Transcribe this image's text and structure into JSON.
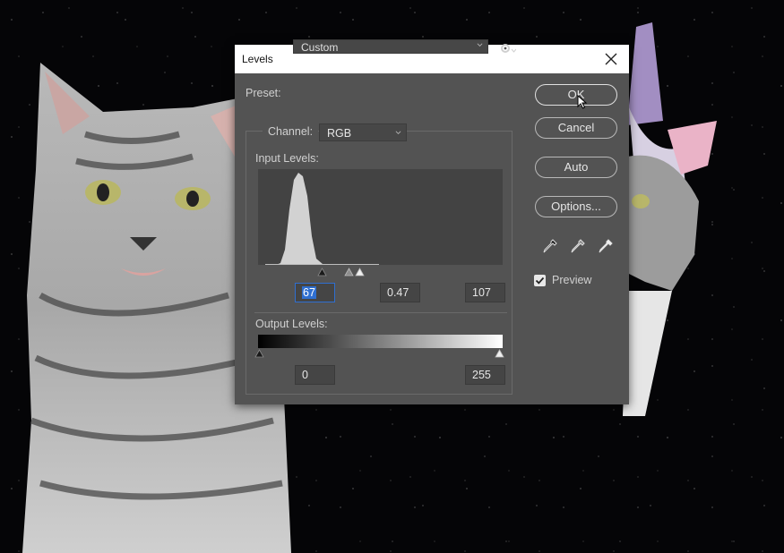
{
  "dialog": {
    "title": "Levels",
    "preset_label": "Preset:",
    "preset_value": "Custom",
    "channel_label": "Channel:",
    "channel_value": "RGB",
    "input_levels_label": "Input Levels:",
    "output_levels_label": "Output Levels:",
    "input_black": "67",
    "input_gamma": "0.47",
    "input_white": "107",
    "output_black": "0",
    "output_white": "255",
    "buttons": {
      "ok": "OK",
      "cancel": "Cancel",
      "auto": "Auto",
      "options": "Options..."
    },
    "preview_label": "Preview",
    "preview_checked": true
  },
  "icons": {
    "close": "close-icon",
    "gear": "gear-icon",
    "eyedropper_black": "eyedropper-black-icon",
    "eyedropper_gray": "eyedropper-gray-icon",
    "eyedropper_white": "eyedropper-white-icon"
  },
  "colors": {
    "dialog_bg": "#535353",
    "accent_selection": "#2f6fd0"
  }
}
